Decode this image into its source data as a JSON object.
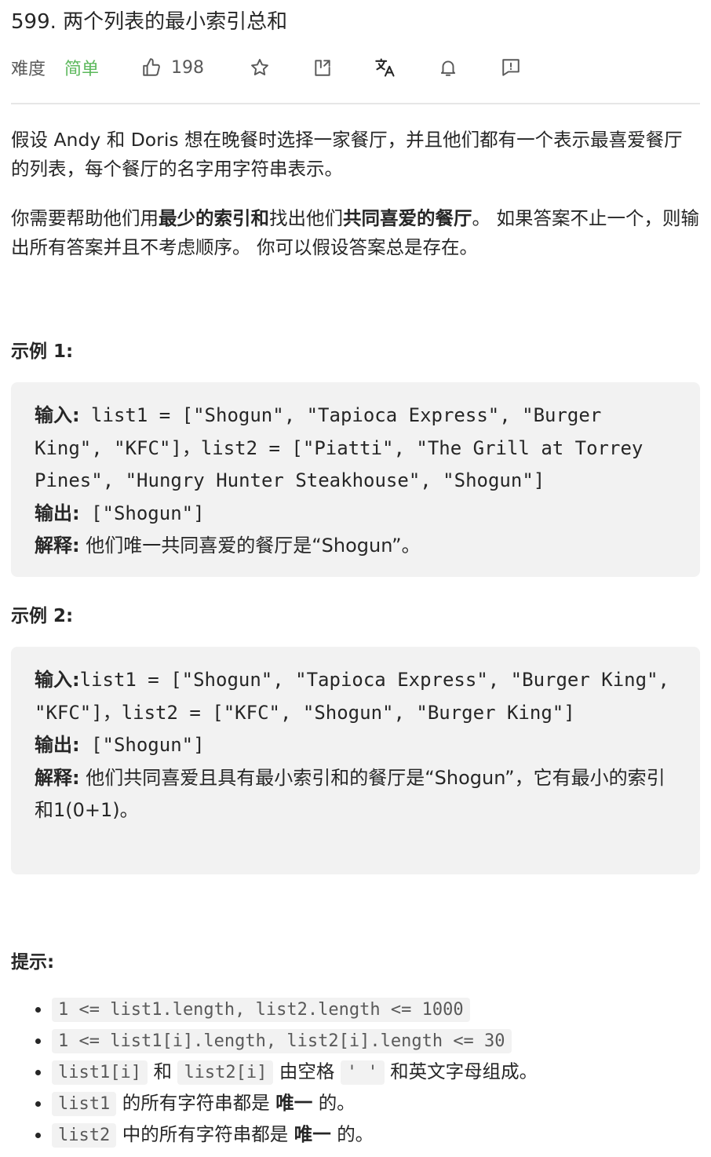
{
  "title": "599. 两个列表的最小索引总和",
  "meta": {
    "difficulty_label": "难度",
    "difficulty_value": "简单",
    "likes": "198"
  },
  "description": {
    "p1": "假设 Andy 和 Doris 想在晚餐时选择一家餐厅，并且他们都有一个表示最喜爱餐厅的列表，每个餐厅的名字用字符串表示。",
    "p2_a": "你需要帮助他们用",
    "p2_b": "最少的索引和",
    "p2_c": "找出他们",
    "p2_d": "共同喜爱的餐厅",
    "p2_e": "。 如果答案不止一个，则输出所有答案并且不考虑顺序。 你可以假设答案总是存在。"
  },
  "example1": {
    "heading": "示例 1:",
    "input_label": "输入:",
    "input_value": " list1 = [\"Shogun\", \"Tapioca Express\", \"Burger King\", \"KFC\"]，list2 = [\"Piatti\", \"The Grill at Torrey Pines\", \"Hungry Hunter Steakhouse\", \"Shogun\"]",
    "output_label": "输出:",
    "output_value": " [\"Shogun\"]",
    "explain_label": "解释:",
    "explain_value": " 他们唯一共同喜爱的餐厅是“Shogun”。"
  },
  "example2": {
    "heading": "示例 2:",
    "input_label": "输入:",
    "input_value": "list1 = [\"Shogun\", \"Tapioca Express\", \"Burger King\", \"KFC\"]，list2 = [\"KFC\", \"Shogun\", \"Burger King\"]",
    "output_label": "输出:",
    "output_value": " [\"Shogun\"]",
    "explain_label": "解释:",
    "explain_value": " 他们共同喜爱且具有最小索引和的餐厅是“Shogun”，它有最小的索引和1(0+1)。"
  },
  "hints": {
    "heading": "提示:",
    "h1_code": "1 <= list1.length, list2.length <= 1000",
    "h2_code": "1 <= list1[i].length, list2[i].length <= 30",
    "h3_code_a": "list1[i]",
    "h3_text_a": "和",
    "h3_code_b": "list2[i]",
    "h3_text_b": "由空格",
    "h3_code_c": "' '",
    "h3_text_c": "和英文字母组成。",
    "h4_code": "list1",
    "h4_text_a": "的所有字符串都是",
    "h4_bold": "唯一",
    "h4_text_b": "的。",
    "h5_code": "list2",
    "h5_text_a": "中的所有字符串都是",
    "h5_bold": "唯一",
    "h5_text_b": "的。"
  },
  "icons": [
    "thumbs-up-icon",
    "star-icon",
    "share-icon",
    "translate-icon",
    "bell-icon",
    "feedback-icon"
  ]
}
